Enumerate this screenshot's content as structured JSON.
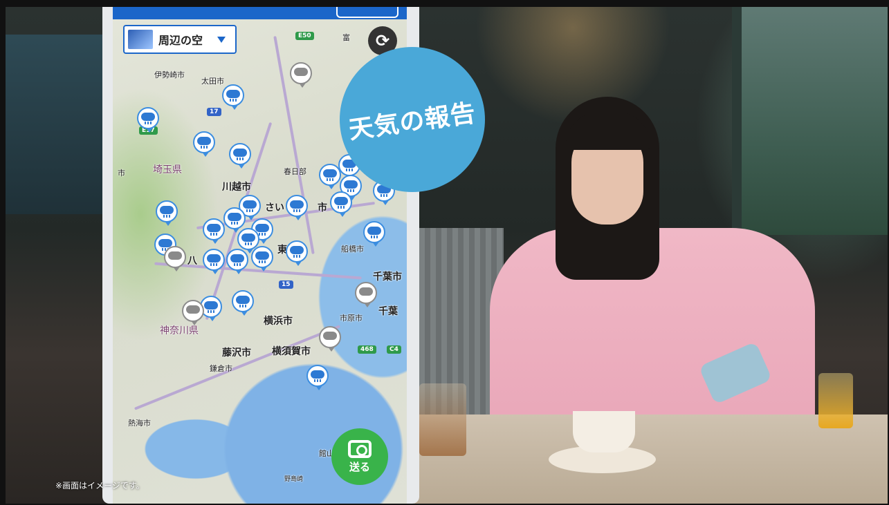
{
  "map": {
    "layer_selector": {
      "label": "周辺の空"
    },
    "refresh_icon": "refresh-icon",
    "places": {
      "isesaki": "伊勢崎市",
      "ota": "太田市",
      "saitama_pref": "埼玉県",
      "kawagoe": "川越市",
      "kasukabe": "春日部",
      "saitama": "さい",
      "funabashi": "船橋市",
      "chiba": "千葉市",
      "chiba_pref": "千葉",
      "kanagawa_pref": "神奈川県",
      "yokohama": "横浜市",
      "ichihara": "市原市",
      "fujisawa": "藤沢市",
      "kamakura": "鎌倉市",
      "yokosuka": "横須賀市",
      "atami": "熱海市",
      "tateyama": "館山",
      "nojima": "野島崎",
      "hachioji": "八",
      "ichi": "市",
      "higashi": "東",
      "tomitsu": "富",
      "tomioka": "市"
    },
    "routes": {
      "e50": "E50",
      "e17": "E17",
      "r17": "17",
      "r15": "15",
      "r468": "468",
      "c4": "C4"
    }
  },
  "send_button": {
    "label": "送る"
  },
  "badge": {
    "text": "天気の報告"
  },
  "disclaimer": "※画面はイメージです。",
  "colors": {
    "accent": "#1b66c9",
    "badge": "#4aa8d8",
    "send": "#39b34a"
  }
}
